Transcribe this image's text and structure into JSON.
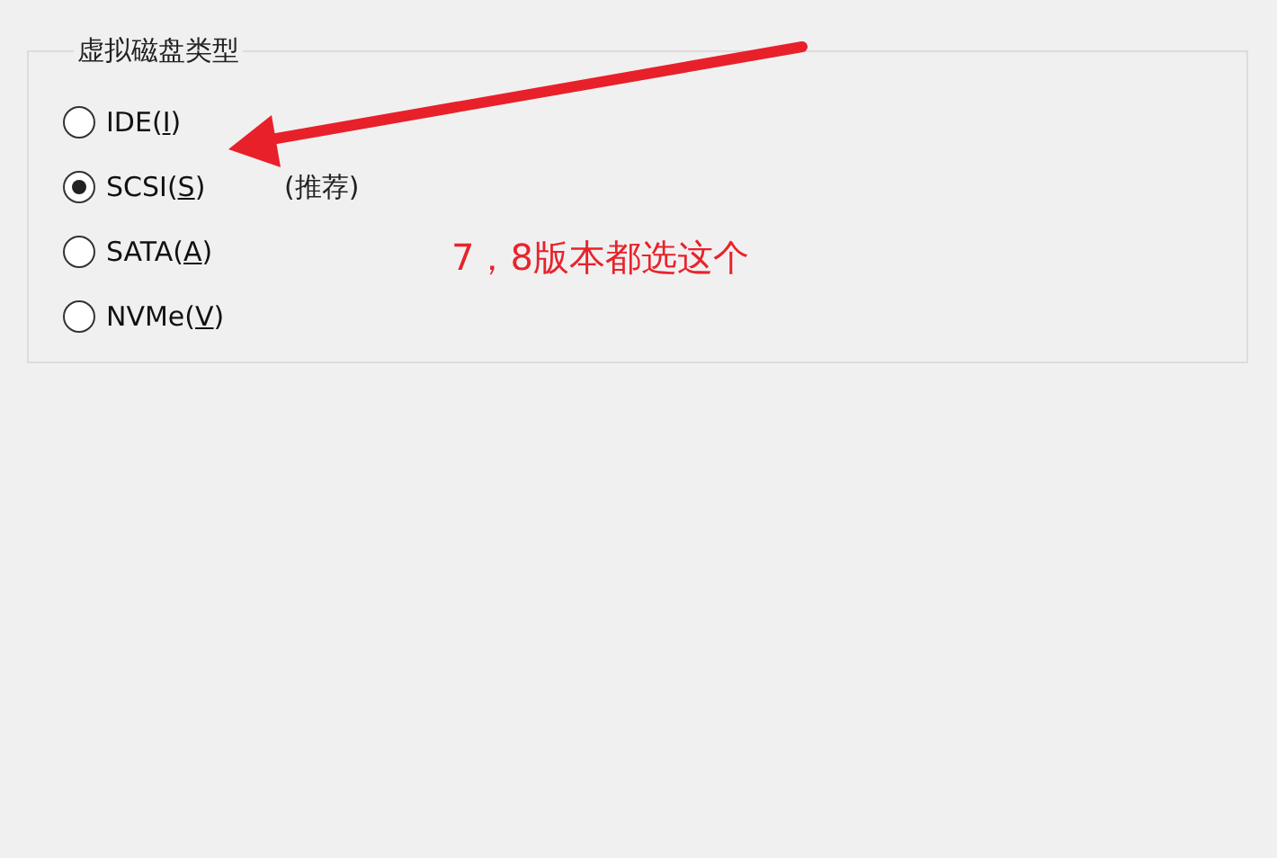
{
  "group": {
    "title": "虚拟磁盘类型",
    "options": [
      {
        "text_before": "IDE(",
        "mnemonic": "I",
        "text_after": ")",
        "selected": false
      },
      {
        "text_before": "SCSI(",
        "mnemonic": "S",
        "text_after": ")",
        "selected": true,
        "note": "(推荐)"
      },
      {
        "text_before": "SATA(",
        "mnemonic": "A",
        "text_after": ")",
        "selected": false
      },
      {
        "text_before": "NVMe(",
        "mnemonic": "V",
        "text_after": ")",
        "selected": false
      }
    ]
  },
  "annotation": {
    "text": "7，8版本都选这个"
  }
}
